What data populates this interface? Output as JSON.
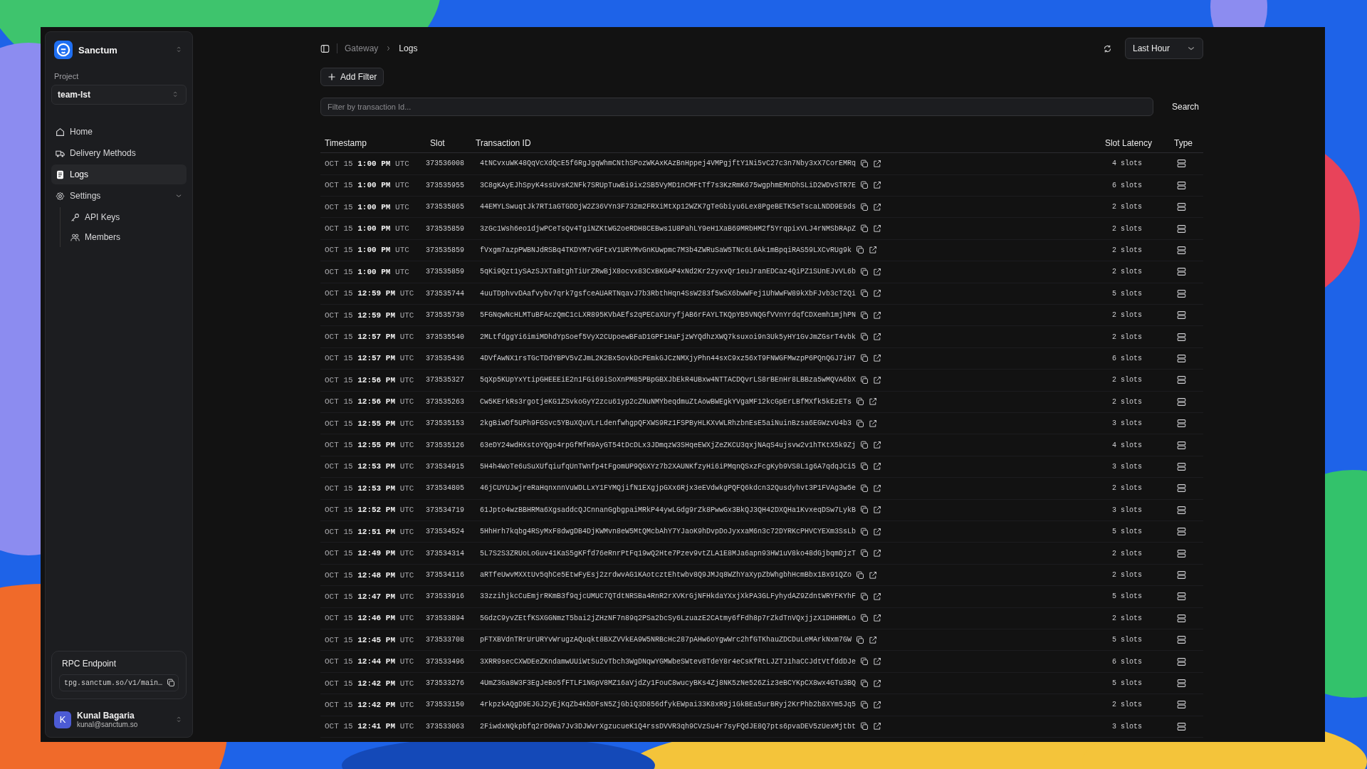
{
  "sidebar": {
    "workspace": "Sanctum",
    "project_label": "Project",
    "project": "team-lst",
    "nav": [
      {
        "label": "Home",
        "kind": "home",
        "selected": false
      },
      {
        "label": "Delivery Methods",
        "kind": "truck",
        "selected": false
      },
      {
        "label": "Logs",
        "kind": "doc",
        "selected": true
      },
      {
        "label": "Settings",
        "kind": "gear",
        "selected": false,
        "expanded": true,
        "children": [
          {
            "label": "API Keys",
            "kind": "key",
            "selected": false
          },
          {
            "label": "Members",
            "kind": "users",
            "selected": false
          }
        ]
      }
    ],
    "rpc": {
      "title": "RPC Endpoint",
      "value": "tpg.sanctum.so/v1/main…"
    },
    "user": {
      "initial": "K",
      "name": "Kunal Bagaria",
      "email": "kunal@sanctum.so"
    }
  },
  "breadcrumb": [
    "Gateway",
    "Logs"
  ],
  "range": "Last Hour",
  "add_filter": "Add Filter",
  "search": {
    "placeholder": "Filter by transaction Id...",
    "button": "Search"
  },
  "table": {
    "columns": [
      "Timestamp",
      "Slot",
      "Transaction ID",
      "Slot Latency",
      "Type"
    ],
    "rows": [
      {
        "date": "OCT 15",
        "time": "1:00 PM",
        "zone": "UTC",
        "slot": "373536008",
        "id": "4tNCvxuWK48QqVcXdQcE5f6RgJgqWhmCNthSPozWKAxKAzBnHppej4VMPgjftY1Ni5vC27c3n7Nby3xX7CorEMRq",
        "latency": "4 slots"
      },
      {
        "date": "OCT 15",
        "time": "1:00 PM",
        "zone": "UTC",
        "slot": "373535955",
        "id": "3C8gKAyEJhSpyK4ssUvsK2NFk7SRUpTuwBi9ix2SB5VyMD1nCMFtTf7s3KzRmK675wgphmEMnDhSLiD2WDvSTR7E",
        "latency": "6 slots"
      },
      {
        "date": "OCT 15",
        "time": "1:00 PM",
        "zone": "UTC",
        "slot": "373535865",
        "id": "44EMYLSwuqtJk7RT1aGTGDDjW2Z36VYn3F732m2FRXiMtXp12WZK7gTeGbiyu6Lex8PgeBETK5eTscaLNDD9E9ds",
        "latency": "2 slots"
      },
      {
        "date": "OCT 15",
        "time": "1:00 PM",
        "zone": "UTC",
        "slot": "373535859",
        "id": "3zGc1Wsh6eo1djwPCeTsQv4TgiNZKtWG2oeRDH8CEBws1U8PahLY9eH1XaB69MRbHM2f5YrqpixVLJ4rNMSbRApZ",
        "latency": "2 slots"
      },
      {
        "date": "OCT 15",
        "time": "1:00 PM",
        "zone": "UTC",
        "slot": "373535859",
        "id": "fVxgm7azpPWBNJdRSBq4TKDYM7vGFtxV1URYMvGnKUwpmc7M3b4ZWRuSaW5TNc6L6Ak1mBpqiRAS59LXCvRUg9k",
        "latency": "2 slots"
      },
      {
        "date": "OCT 15",
        "time": "1:00 PM",
        "zone": "UTC",
        "slot": "373535859",
        "id": "5qKi9Qzt1ySAzSJXTa8tghTiUrZRwBjX8ocvx83CxBKGAP4xNd2Kr2zyxvQr1euJranEDCaz4QiPZ1SUnEJvVL6b",
        "latency": "2 slots"
      },
      {
        "date": "OCT 15",
        "time": "12:59 PM",
        "zone": "UTC",
        "slot": "373535744",
        "id": "4uuTDphvvDAafvybv7qrk7gsfceAUARTNqavJ7b3RbthHqn4SsW283f5wSX6bwWFej1UhWwFW89kXbFJvb3cT2Qi",
        "latency": "5 slots"
      },
      {
        "date": "OCT 15",
        "time": "12:59 PM",
        "zone": "UTC",
        "slot": "373535730",
        "id": "5FGNqwNcHLMTuBFAczQmC1cLXR895KVbAEfs2qPECaXUryfjAB6rFAYLTKQpYB5VNQGfVVnYrdqfCDXemh1mjhPN",
        "latency": "2 slots"
      },
      {
        "date": "OCT 15",
        "time": "12:57 PM",
        "zone": "UTC",
        "slot": "373535540",
        "id": "2MLtfdggYi6imiMDhdYpSoef5VyX2CUpoewBFaD1GPF1HaFjzWYQdhzXWQ7ksuxoi9n3Uk5yHY1GvJmZGsrT4vbk",
        "latency": "2 slots"
      },
      {
        "date": "OCT 15",
        "time": "12:57 PM",
        "zone": "UTC",
        "slot": "373535436",
        "id": "4DVfAwNX1rsTGcTDdYBPV5vZJmL2K2Bx5ovkDcPEmkGJCzNMXjyPhn44sxC9xz56xT9FNWGFMwzpP6PQnQGJ7iH7",
        "latency": "6 slots"
      },
      {
        "date": "OCT 15",
        "time": "12:56 PM",
        "zone": "UTC",
        "slot": "373535327",
        "id": "5qXp5KUpYxYtipGHEEEiE2n1FGi69iSoXnPM85PBpGBXJbEkR4UBxw4NTTACDQvrLS8rBEnHr8LBBza5wMQVA6bX",
        "latency": "2 slots"
      },
      {
        "date": "OCT 15",
        "time": "12:56 PM",
        "zone": "UTC",
        "slot": "373535263",
        "id": "Cw5KErkRs3rgotjeKG1ZSvkoGyY2zcu61yp2cZNuNMYbeqdmuZtAowBWEgkYVgaMF12kcGpErLBfMXfk5kEzETs",
        "latency": "2 slots"
      },
      {
        "date": "OCT 15",
        "time": "12:55 PM",
        "zone": "UTC",
        "slot": "373535153",
        "id": "2kgBiwDf5UPh9FGSvc5YBuXQuVLrLdenfwhgpQFXWS9Rz1FSPByHLKXvWLRhzbnEsE5aiNuinBzsa6EGWzvU4b3",
        "latency": "3 slots"
      },
      {
        "date": "OCT 15",
        "time": "12:55 PM",
        "zone": "UTC",
        "slot": "373535126",
        "id": "63eDY24wdHXstoYQgo4rpGfMfH9AyGT54tDcDLx3JDmqzW3SHqeEWXjZeZKCU3qxjNAqS4ujsvw2v1hTKtX5k9Zj",
        "latency": "4 slots"
      },
      {
        "date": "OCT 15",
        "time": "12:53 PM",
        "zone": "UTC",
        "slot": "373534915",
        "id": "5H4h4WoTe6uSuXUfqiufqUnTWnfp4tFgomUP9QGXYz7b2XAUNKfzyHi6iPMqnQSxzFcgKyb9VS8L1g6A7qdqJCi5",
        "latency": "3 slots"
      },
      {
        "date": "OCT 15",
        "time": "12:53 PM",
        "zone": "UTC",
        "slot": "373534805",
        "id": "46jCUYUJwjreRaHqnxnnVuWDLLxY1FYMQjifN1EXgjpGXx6Rjx3eEVdwkgPQFQ6kdcn32Qusdyhvt3P1FVAg3w5e",
        "latency": "2 slots"
      },
      {
        "date": "OCT 15",
        "time": "12:52 PM",
        "zone": "UTC",
        "slot": "373534719",
        "id": "61Jpto4wzBBHRMa6XgsaddcQJCnnanGgbgpaiMRkP44ywLGdg9rZk8PwwGx3BkQJ3QH42DXQHa1KvxeqDSw7LykB",
        "latency": "3 slots"
      },
      {
        "date": "OCT 15",
        "time": "12:51 PM",
        "zone": "UTC",
        "slot": "373534524",
        "id": "5HhHrh7kqbg4RSyMxF8dwgDB4DjKWMvn8eW5MtQMcbAhY7YJaoK9hDvpDoJyxxaM6n3c72DYRKcPHVCYEXm3SsLb",
        "latency": "5 slots"
      },
      {
        "date": "OCT 15",
        "time": "12:49 PM",
        "zone": "UTC",
        "slot": "373534314",
        "id": "5L7S2S3ZRUoLoGuv41KaS5gKFfd76eRnrPtFq19wQ2Hte7Pzev9vtZLA1E8MJa6apn93HW1uV8ko48dGjbqmDjzT",
        "latency": "2 slots"
      },
      {
        "date": "OCT 15",
        "time": "12:48 PM",
        "zone": "UTC",
        "slot": "373534116",
        "id": "aRTfeUwvMXXtUv5qhCe5EtwFyEsj2zrdwvAG1KAotcztEhtwbv8Q9JMJq8WZhYaXypZbWhgbhHcmBbx1Bx91QZo",
        "latency": "2 slots"
      },
      {
        "date": "OCT 15",
        "time": "12:47 PM",
        "zone": "UTC",
        "slot": "373533916",
        "id": "33zzihjkcCuEmjrRKmB3f9qjcUMUC7QTdtNRSBa4RnR2rXVKrGjNFHkdaYXxjXkPA3GLFyhydAZ9ZdntWRYFKYhF",
        "latency": "5 slots"
      },
      {
        "date": "OCT 15",
        "time": "12:46 PM",
        "zone": "UTC",
        "slot": "373533894",
        "id": "5GdzC9yvZEtfKSXGGNmzT5bai2jZHzNF7n89q2PSa2bcSy6LzuazE2CAtmy6fFdh8p7rZkdTnVQxjjzX1DHHRMLo",
        "latency": "2 slots"
      },
      {
        "date": "OCT 15",
        "time": "12:45 PM",
        "zone": "UTC",
        "slot": "373533708",
        "id": "pFTXBVdnTRrUrURYvWrugzAQuqkt8BXZVVkEA9W5NRBcHc287pAHw6oYgwWrc2hfGTKhauZDCDuLeMArkNxm7GW",
        "latency": "5 slots"
      },
      {
        "date": "OCT 15",
        "time": "12:44 PM",
        "zone": "UTC",
        "slot": "373533496",
        "id": "3XRR9secCXWDEeZKndamwUUiWtSu2vTbch3WgDNqwYGMWbeSWtev8TdeY8r4eCsKfRtLJZTJ1haCCJdtVtfddDJe",
        "latency": "6 slots"
      },
      {
        "date": "OCT 15",
        "time": "12:42 PM",
        "zone": "UTC",
        "slot": "373533276",
        "id": "4UmZ3Ga8W3F3EgJeBo5fFTLF1NGpV8MZ16aVjdZy1FouC8wucyBKs4Zj8NK5zNe526Ziz3eBCYKpCX8wx4GTu3BQ",
        "latency": "5 slots"
      },
      {
        "date": "OCT 15",
        "time": "12:42 PM",
        "zone": "UTC",
        "slot": "373533150",
        "id": "4rkpzkAQgD9EJGJ2yEjKqZb4KbDFsN5ZjGbiQ3D856dfykEWpai33K8xR9j1GkBEa5urBRyj2KrPhb2b8XYm5Jq5",
        "latency": "2 slots"
      },
      {
        "date": "OCT 15",
        "time": "12:41 PM",
        "zone": "UTC",
        "slot": "373533063",
        "id": "2FiwdxNQkpbfq2rD9Wa7Jv3DJWvrXgzucueK1Q4rssDVVR3qh9CVzSu4r7syFQdJE8Q7pts6pvaDEV5zUexMjtbt",
        "latency": "3 slots"
      }
    ]
  }
}
